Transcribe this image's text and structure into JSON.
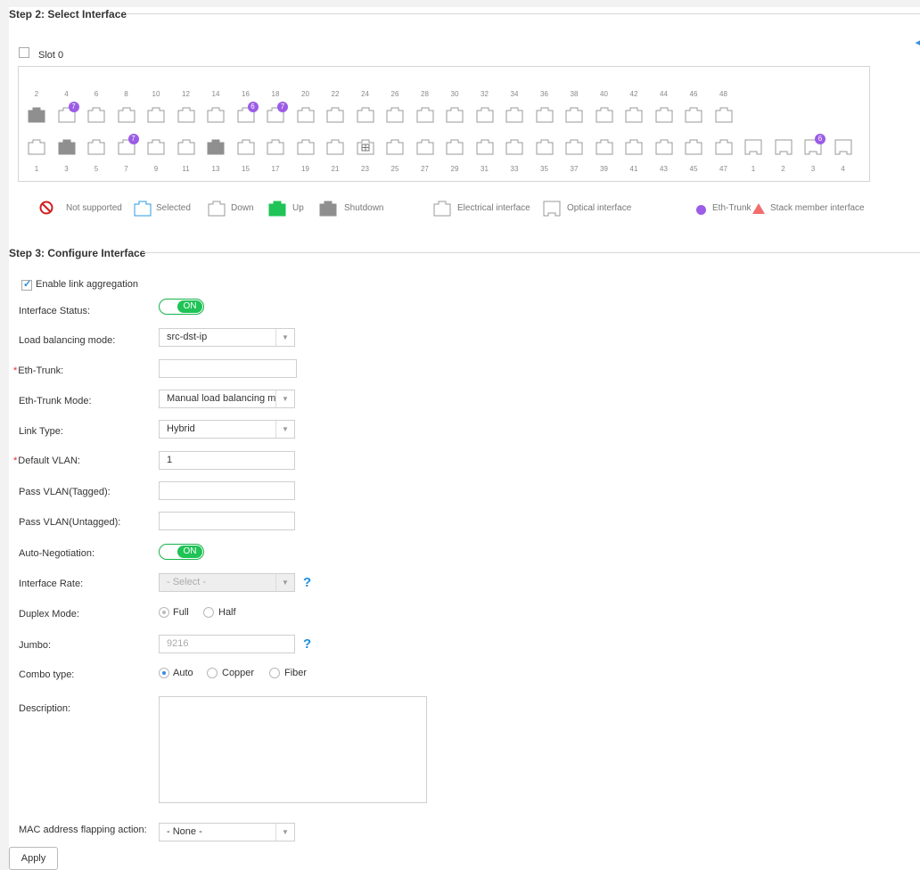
{
  "step2": {
    "title": "Step 2: Select Interface",
    "slot_label": "Slot 0",
    "top_numbers": [
      "2",
      "4",
      "6",
      "8",
      "10",
      "12",
      "14",
      "16",
      "18",
      "20",
      "22",
      "24",
      "26",
      "28",
      "30",
      "32",
      "34",
      "36",
      "38",
      "40",
      "42",
      "44",
      "46",
      "48"
    ],
    "bottom_numbers": [
      "1",
      "3",
      "5",
      "7",
      "9",
      "11",
      "13",
      "15",
      "17",
      "19",
      "21",
      "23",
      "25",
      "27",
      "29",
      "31",
      "33",
      "35",
      "37",
      "39",
      "41",
      "43",
      "45",
      "47",
      "1",
      "2",
      "3",
      "4"
    ],
    "top_ports": [
      {
        "state": "shutdown"
      },
      {
        "state": "down",
        "badge": "7"
      },
      {
        "state": "down"
      },
      {
        "state": "down"
      },
      {
        "state": "down"
      },
      {
        "state": "down"
      },
      {
        "state": "down"
      },
      {
        "state": "down",
        "badge": "6"
      },
      {
        "state": "down",
        "badge": "7"
      },
      {
        "state": "down"
      },
      {
        "state": "down"
      },
      {
        "state": "down"
      },
      {
        "state": "down"
      },
      {
        "state": "down"
      },
      {
        "state": "down"
      },
      {
        "state": "down"
      },
      {
        "state": "down"
      },
      {
        "state": "down"
      },
      {
        "state": "down"
      },
      {
        "state": "down"
      },
      {
        "state": "down"
      },
      {
        "state": "down"
      },
      {
        "state": "down"
      },
      {
        "state": "down"
      }
    ],
    "bottom_ports": [
      {
        "state": "down"
      },
      {
        "state": "shutdown"
      },
      {
        "state": "down"
      },
      {
        "state": "down",
        "badge": "7"
      },
      {
        "state": "down"
      },
      {
        "state": "down"
      },
      {
        "state": "shutdown"
      },
      {
        "state": "down"
      },
      {
        "state": "down"
      },
      {
        "state": "down"
      },
      {
        "state": "down"
      },
      {
        "state": "special"
      },
      {
        "state": "down"
      },
      {
        "state": "down"
      },
      {
        "state": "down"
      },
      {
        "state": "down"
      },
      {
        "state": "down"
      },
      {
        "state": "down"
      },
      {
        "state": "down"
      },
      {
        "state": "down"
      },
      {
        "state": "down"
      },
      {
        "state": "down"
      },
      {
        "state": "down"
      },
      {
        "state": "down"
      },
      {
        "state": "optical"
      },
      {
        "state": "optical"
      },
      {
        "state": "optical",
        "badge": "6"
      },
      {
        "state": "optical"
      }
    ],
    "legend": {
      "not_supported": "Not supported",
      "selected": "Selected",
      "down": "Down",
      "up": "Up",
      "shutdown": "Shutdown",
      "electrical": "Electrical interface",
      "optical": "Optical interface",
      "eth_trunk": "Eth-Trunk",
      "stack_member": "Stack member interface"
    }
  },
  "step3": {
    "title": "Step 3: Configure Interface",
    "enable_link_aggregation": "Enable link aggregation",
    "interface_status": {
      "label": "Interface Status:",
      "value": "ON"
    },
    "load_balancing": {
      "label": "Load balancing mode:",
      "value": "src-dst-ip"
    },
    "eth_trunk": {
      "label": "Eth-Trunk:",
      "required": "*",
      "value": ""
    },
    "eth_trunk_mode": {
      "label": "Eth-Trunk Mode:",
      "value": "Manual load balancing m"
    },
    "link_type": {
      "label": "Link Type:",
      "value": "Hybrid"
    },
    "default_vlan": {
      "label": "Default VLAN:",
      "required": "*",
      "value": "1"
    },
    "pass_vlan_tagged": {
      "label": "Pass VLAN(Tagged):",
      "value": ""
    },
    "pass_vlan_untagged": {
      "label": "Pass VLAN(Untagged):",
      "value": ""
    },
    "auto_negotiation": {
      "label": "Auto-Negotiation:",
      "value": "ON"
    },
    "interface_rate": {
      "label": "Interface Rate:",
      "value": "- Select -",
      "help": "?"
    },
    "duplex_mode": {
      "label": "Duplex Mode:",
      "options": [
        "Full",
        "Half"
      ],
      "selected": "Full"
    },
    "jumbo": {
      "label": "Jumbo:",
      "value": "9216",
      "help": "?"
    },
    "combo_type": {
      "label": "Combo type:",
      "options": [
        "Auto",
        "Copper",
        "Fiber"
      ],
      "selected": "Auto"
    },
    "description": {
      "label": "Description:",
      "value": ""
    },
    "mac_flapping": {
      "label": "MAC address flapping action:",
      "value": "- None -"
    },
    "apply": "Apply"
  },
  "colors": {
    "eth_trunk": "#9c5ce6",
    "up": "#1fc356",
    "shutdown": "#8f8f8f",
    "selected": "#2a9be3",
    "accent": "#1d8fe0",
    "required": "#e0302e"
  }
}
